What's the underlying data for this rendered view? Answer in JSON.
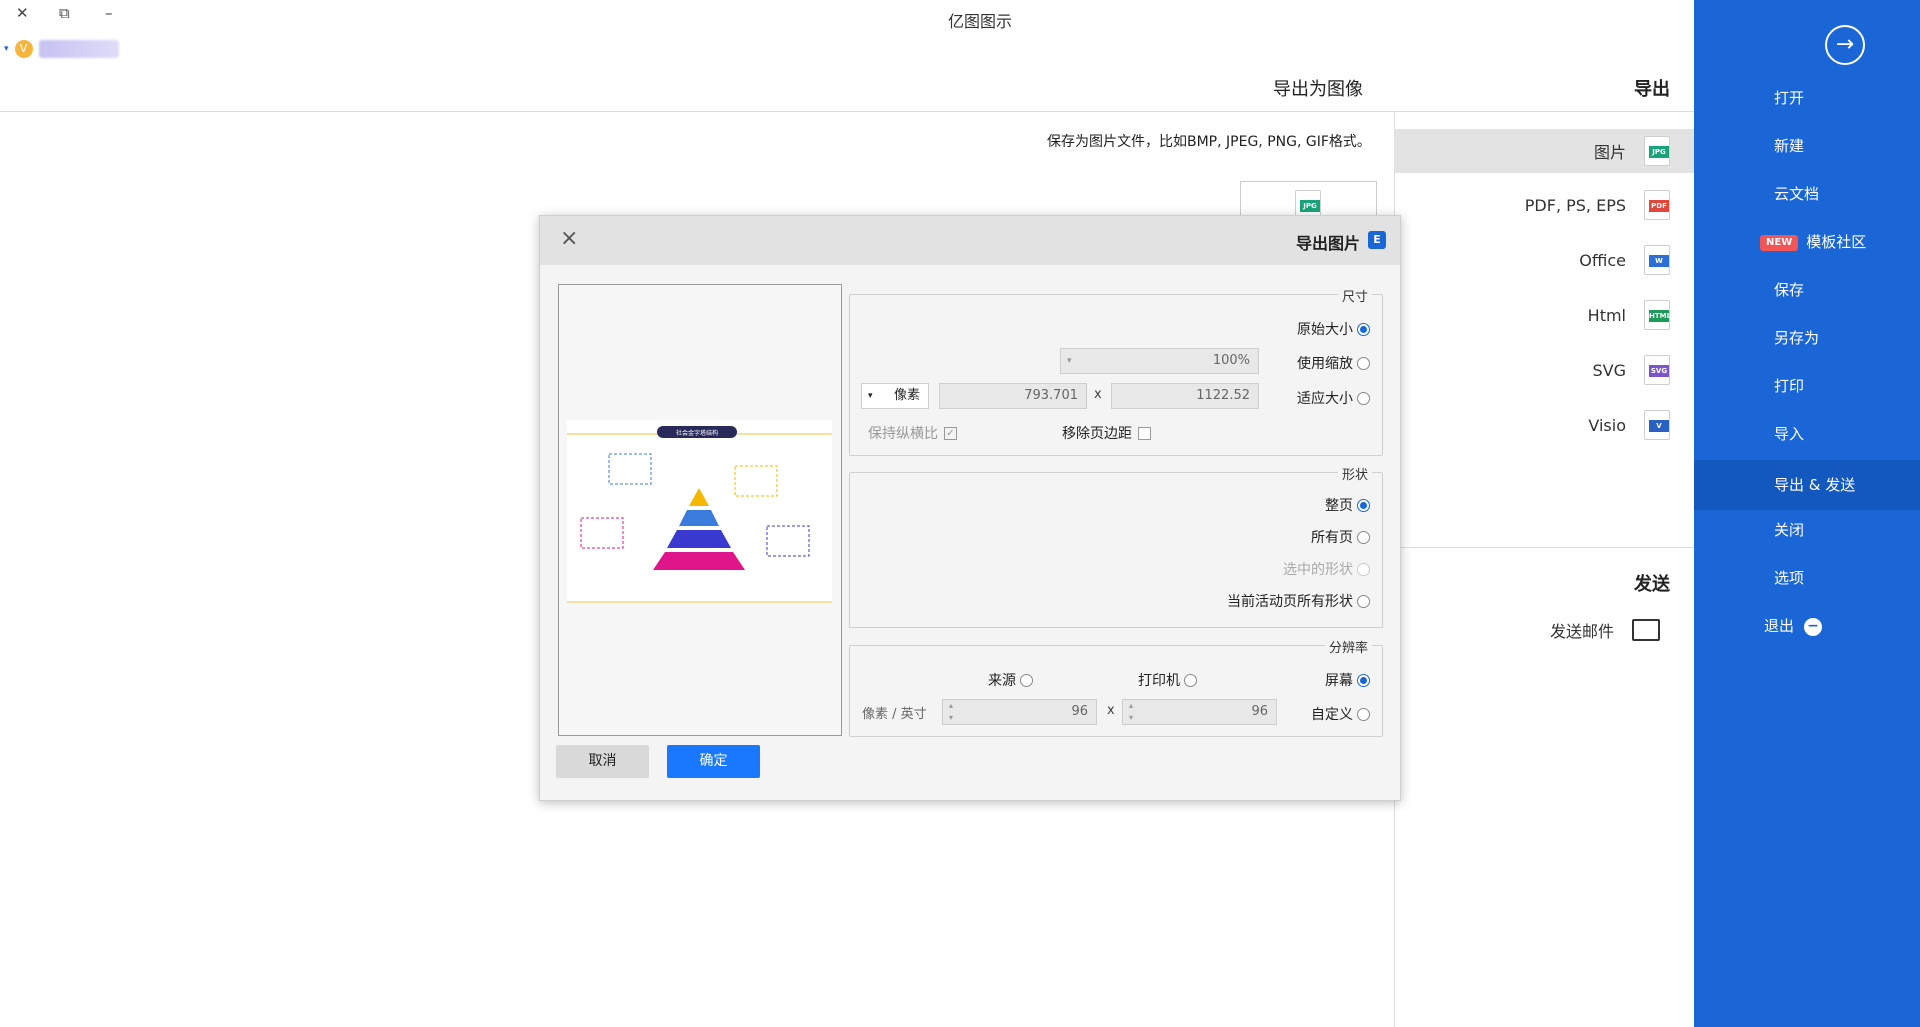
{
  "window": {
    "title": "亿图图示",
    "close_glyph": "✕",
    "restore_glyph": "⧉",
    "minimize_glyph": "–"
  },
  "sidebar": {
    "back_icon": "arrow-right-icon",
    "items": [
      {
        "label": "打开"
      },
      {
        "label": "新建"
      },
      {
        "label": "云文档"
      },
      {
        "label": "模板社区",
        "badge": "NEW"
      },
      {
        "label": "保存"
      },
      {
        "label": "另存为"
      },
      {
        "label": "打印"
      },
      {
        "label": "导入"
      },
      {
        "label": "导出 & 发送",
        "active": true
      },
      {
        "label": "关闭"
      },
      {
        "label": "选项"
      },
      {
        "label": "退出"
      }
    ],
    "colors": {
      "bg": "#1a66d6",
      "active": "#1258bf"
    }
  },
  "export": {
    "heading": "导出",
    "sub_heading": "导出为图像",
    "description": "保存为图片文件，比如BMP, JPEG, PNG, GIF格式。",
    "formats": [
      {
        "label": "图片",
        "tag": "JPG",
        "color": "#1aa37a",
        "active": true
      },
      {
        "label": "PDF, PS, EPS",
        "tag": "PDF",
        "color": "#e0473a"
      },
      {
        "label": "Office",
        "tag": "W",
        "color": "#2b6fd6"
      },
      {
        "label": "Html",
        "tag": "HTML",
        "color": "#1d9a5a"
      },
      {
        "label": "SVG",
        "tag": "SVG",
        "color": "#7a56c9"
      },
      {
        "label": "Visio",
        "tag": "V",
        "color": "#2a5fc4"
      }
    ]
  },
  "send": {
    "heading": "发送",
    "email_label": "发送邮件"
  },
  "dialog": {
    "title": "导出图片",
    "size_group": {
      "title": "尺寸",
      "original": "原始大小",
      "use_zoom": "使用缩放",
      "zoom_value": "100%",
      "fit_size": "适应大小",
      "width": "1122.52",
      "height": "793.701",
      "unit": "像素",
      "remove_margin": "移除页边距",
      "keep_ratio": "保持纵横比"
    },
    "shape_group": {
      "title": "形状",
      "whole_page": "整页",
      "all_pages": "所有页",
      "selected_shapes": "选中的形状",
      "current_page_shapes": "当前活动页所有形状"
    },
    "resolution_group": {
      "title": "分辨率",
      "screen": "屏幕",
      "printer": "打印机",
      "source": "来源",
      "custom": "自定义",
      "dpi_x": "96",
      "dpi_y": "96",
      "dpi_unit": "像素 / 英寸"
    },
    "ok_label": "确定",
    "cancel_label": "取消",
    "preview_title": "社会金字塔结构"
  }
}
